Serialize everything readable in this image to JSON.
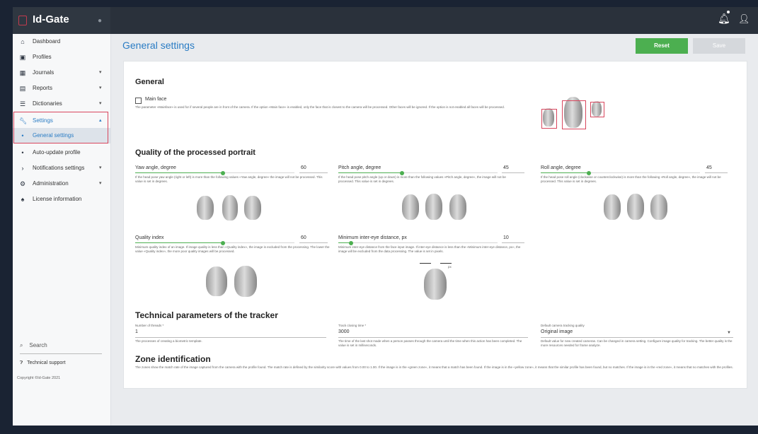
{
  "app": {
    "name": "Id-Gate"
  },
  "sidebar": {
    "items": [
      {
        "label": "Dashboard",
        "icon": "home-icon"
      },
      {
        "label": "Profiles",
        "icon": "id-card-icon"
      },
      {
        "label": "Journals",
        "icon": "table-icon"
      },
      {
        "label": "Reports",
        "icon": "report-icon"
      },
      {
        "label": "Dictionaries",
        "icon": "list-icon"
      },
      {
        "label": "Settings",
        "icon": "wrench-icon"
      },
      {
        "label": "General settings",
        "icon": "dot-icon"
      },
      {
        "label": "Auto-update profile",
        "icon": "dot-icon"
      },
      {
        "label": "Notifications settings",
        "icon": "chevron-right-icon"
      },
      {
        "label": "Administration",
        "icon": "gear-icon"
      },
      {
        "label": "License information",
        "icon": "license-icon"
      }
    ],
    "search_label": "Search",
    "support_label": "Technical support",
    "copyright": "Copyright ©Id-Gate 2021"
  },
  "header": {
    "title": "General settings",
    "reset_label": "Reset",
    "save_label": "Save"
  },
  "general": {
    "title": "General",
    "main_face_label": "Main face",
    "main_face_desc": "The parameter «Mainface» is used for if several people are in front of the camera. If the option «Main face» is enabled, only the face that is closest to the camera will be processed. Other faces will be ignored. If the option is not enabled all faces will be processed."
  },
  "quality": {
    "title": "Quality of the processed portrait",
    "yaw": {
      "label": "Yaw angle, degree",
      "value": "60",
      "fraction": 0.55,
      "desc": "If the head pose yaw angle (right or left) is more than the following values «Yaw angle, degree» the image will not be processed. This value is set in degrees."
    },
    "pitch": {
      "label": "Pitch angle, degree",
      "value": "45",
      "fraction": 0.4,
      "desc": "If the head pose pitch angle (up or down) is more than the following values «Pitch angle, degree», the image will not be processed. This value is set in degrees."
    },
    "roll": {
      "label": "Roll angle, degree",
      "value": "45",
      "fraction": 0.3,
      "desc": "If the head pose roll angle (clockwise or counterclockwise) is more than the following «Roll angle, degree», the image will not be processed. This value is set in degrees."
    },
    "quality_index": {
      "label": "Quality index",
      "value": "60",
      "fraction": 0.55,
      "desc": "Minimum quality index of an image. If image quality is less than «Quality index», the image is excluded from the processing. The lower the value «Quality index», the more poor quality images will be processed."
    },
    "inter_eye": {
      "label": "Minimum inter-eye distance, px",
      "value": "10",
      "fraction": 0.08,
      "desc": "Minimum inter-eye distance from the face input image. If inter-eye distance is less than the «Minimum inter-eye distance, px», the image will be excluded from the data processing. The value is set in pixels."
    },
    "px_label": "px"
  },
  "tracker": {
    "title": "Technical parameters of the tracker",
    "threads": {
      "label": "Number of threads *",
      "value": "1",
      "desc": "The processes of creating a biometric template."
    },
    "closing": {
      "label": "Track closing time *",
      "value": "3000",
      "desc": "The time of the last shot made when a person passes through the camera until the time when this action has been completed. The value is set in milliseconds."
    },
    "camera_quality": {
      "label": "Default camera tracking quality",
      "value": "Original image",
      "desc": "Default value for new created cameras. Can be changed in camera setting. Configure image quality for tracking. The better quality is the more resources needed for frame analyze."
    }
  },
  "zone": {
    "title": "Zone identification",
    "desc": "The zones show the match rate of the image captured from the camera with the profile found. The match rate is defined by the similarity score with values from 0.00 to 1.00. If the image is in the «green zone», it means that a match has been found. If the image is in the «yellow zone», it means that the similar profile has been found, but no matches. If the image is in the «red zone», it means that no matches with the profiles."
  },
  "colors": {
    "accent": "#2a7cc4",
    "green": "#4caf50",
    "highlight": "#d8465d",
    "topbar": "#2a313b"
  }
}
